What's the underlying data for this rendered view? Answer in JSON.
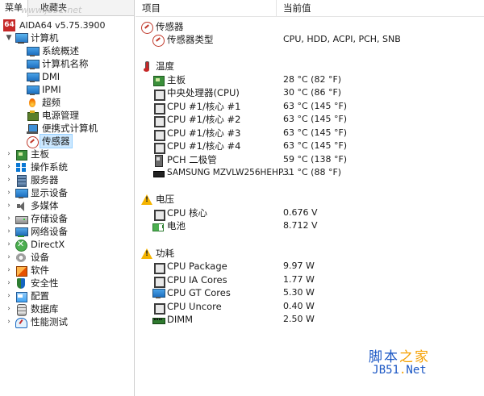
{
  "tabs": {
    "menu": "菜单",
    "favorites": "收藏夹"
  },
  "watermark_top": "www.jb51.net",
  "app": {
    "logo": "64",
    "name": "AIDA64 v5.75.3900"
  },
  "tree": [
    {
      "id": "computer",
      "label": "计算机",
      "icon": "computer-icon",
      "expanded": true,
      "level": 0
    },
    {
      "id": "summary",
      "label": "系统概述",
      "icon": "monitor-icon",
      "level": 1
    },
    {
      "id": "computer-name",
      "label": "计算机名称",
      "icon": "monitor-icon",
      "level": 1
    },
    {
      "id": "dmi",
      "label": "DMI",
      "icon": "monitor-icon",
      "level": 1
    },
    {
      "id": "ipmi",
      "label": "IPMI",
      "icon": "monitor-icon",
      "level": 1
    },
    {
      "id": "overclock",
      "label": "超频",
      "icon": "flame-icon",
      "level": 1
    },
    {
      "id": "power",
      "label": "电源管理",
      "icon": "power-icon",
      "level": 1
    },
    {
      "id": "portable",
      "label": "便携式计算机",
      "icon": "laptop-icon",
      "level": 1
    },
    {
      "id": "sensor",
      "label": "传感器",
      "icon": "sensor-icon",
      "level": 1,
      "selected": true
    },
    {
      "id": "motherboard",
      "label": "主板",
      "icon": "motherboard-icon",
      "level": 0
    },
    {
      "id": "os",
      "label": "操作系统",
      "icon": "windows-icon",
      "level": 0
    },
    {
      "id": "server",
      "label": "服务器",
      "icon": "server-icon",
      "level": 0
    },
    {
      "id": "display",
      "label": "显示设备",
      "icon": "monitor-icon",
      "level": 0
    },
    {
      "id": "multimedia",
      "label": "多媒体",
      "icon": "speaker-icon",
      "level": 0
    },
    {
      "id": "storage",
      "label": "存储设备",
      "icon": "storage-icon",
      "level": 0
    },
    {
      "id": "network",
      "label": "网络设备",
      "icon": "network-icon",
      "level": 0
    },
    {
      "id": "directx",
      "label": "DirectX",
      "icon": "directx-icon",
      "level": 0
    },
    {
      "id": "devices",
      "label": "设备",
      "icon": "devices-icon",
      "level": 0
    },
    {
      "id": "software",
      "label": "软件",
      "icon": "software-icon",
      "level": 0
    },
    {
      "id": "security",
      "label": "安全性",
      "icon": "security-icon",
      "level": 0
    },
    {
      "id": "config",
      "label": "配置",
      "icon": "config-icon",
      "level": 0
    },
    {
      "id": "database",
      "label": "数据库",
      "icon": "database-icon",
      "level": 0
    },
    {
      "id": "benchmark",
      "label": "性能测试",
      "icon": "benchmark-icon",
      "level": 0
    }
  ],
  "columns": {
    "item": "项目",
    "value": "当前值"
  },
  "groups": {
    "sensor": {
      "title": "传感器",
      "rows": [
        {
          "label": "传感器类型",
          "value": "CPU, HDD, ACPI, PCH, SNB",
          "icon": "sensor-icon"
        }
      ]
    },
    "temperature": {
      "title": "温度",
      "rows": [
        {
          "label": "主板",
          "value": "28 °C  (82 °F)",
          "icon": "motherboard-icon"
        },
        {
          "label": "中央处理器(CPU)",
          "value": "30 °C  (86 °F)",
          "icon": "chip-icon"
        },
        {
          "label": "CPU #1/核心 #1",
          "value": "63 °C  (145 °F)",
          "icon": "chip-icon"
        },
        {
          "label": "CPU #1/核心 #2",
          "value": "63 °C  (145 °F)",
          "icon": "chip-icon"
        },
        {
          "label": "CPU #1/核心 #3",
          "value": "63 °C  (145 °F)",
          "icon": "chip-icon"
        },
        {
          "label": "CPU #1/核心 #4",
          "value": "63 °C  (145 °F)",
          "icon": "chip-icon"
        },
        {
          "label": "PCH 二极管",
          "value": "59 °C  (138 °F)",
          "icon": "pch-icon"
        },
        {
          "label": "SAMSUNG MZVLW256HEHP...",
          "value": "31 °C  (88 °F)",
          "icon": "disk-icon"
        }
      ]
    },
    "voltage": {
      "title": "电压",
      "rows": [
        {
          "label": "CPU 核心",
          "value": "0.676 V",
          "icon": "chip-icon"
        },
        {
          "label": "电池",
          "value": "8.712 V",
          "icon": "battery-icon"
        }
      ]
    },
    "power": {
      "title": "功耗",
      "rows": [
        {
          "label": "CPU Package",
          "value": "9.97 W",
          "icon": "chip-icon"
        },
        {
          "label": "CPU IA Cores",
          "value": "1.77 W",
          "icon": "chip-icon"
        },
        {
          "label": "CPU GT Cores",
          "value": "5.30 W",
          "icon": "gpu-icon"
        },
        {
          "label": "CPU Uncore",
          "value": "0.40 W",
          "icon": "chip-icon"
        },
        {
          "label": "DIMM",
          "value": "2.50 W",
          "icon": "dimm-icon"
        }
      ]
    }
  },
  "watermark": {
    "cn_main": "脚本",
    "cn_accent": "之家",
    "en_main": "JB51",
    "en_accent": ".",
    "en_tail": "Net"
  }
}
